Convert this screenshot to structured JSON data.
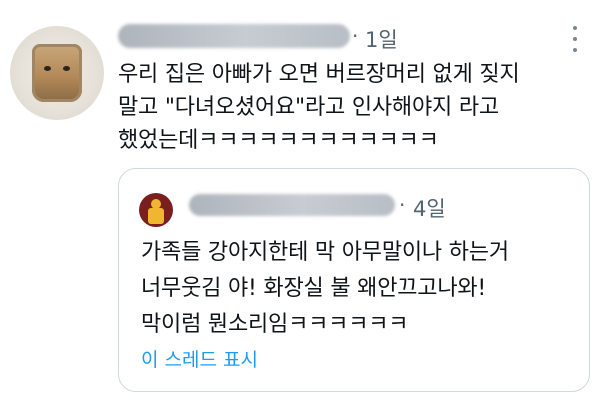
{
  "tweet": {
    "time": "1일",
    "separator": "·",
    "text_lines": [
      "우리 집은 아빠가 오면 버르장머리 없게 짖지",
      "말고 \"다녀오셨어요\"라고 인사해야지 라고",
      "했었는데ㅋㅋㅋㅋㅋㅋㅋㅋㅋㅋㅋㅋ"
    ],
    "avatar_icon": "cat-photo-avatar",
    "more_icon": "more-options-icon"
  },
  "quote": {
    "time": "4일",
    "separator": "·",
    "text_lines": [
      "가족들 강아지한테 막 아무말이나 하는거",
      "너무웃김 야! 화장실 불 왜안끄고나와!",
      "막이럼 뭔소리임ㅋㅋㅋㅋㅋㅋ"
    ],
    "show_thread": "이 스레드 표시",
    "avatar_icon": "cartoon-character-avatar"
  },
  "colors": {
    "text": "#0f1419",
    "muted": "#536471",
    "link": "#1d9bf0",
    "border": "#cfd9de"
  }
}
